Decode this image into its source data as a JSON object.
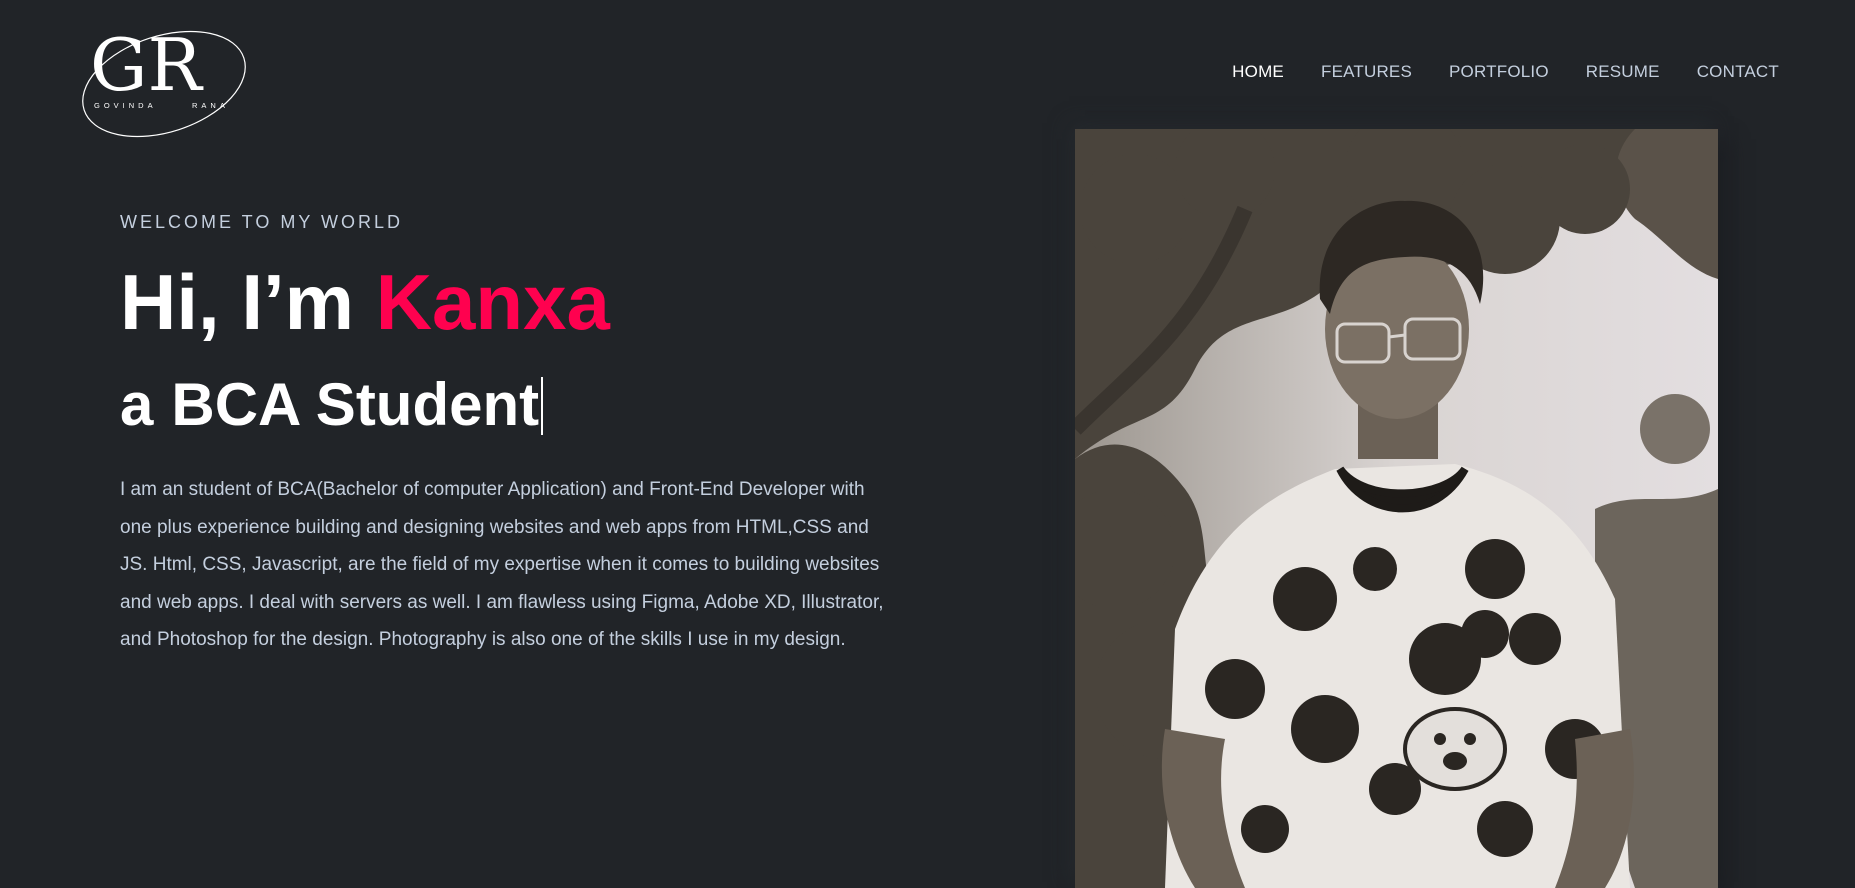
{
  "brand": {
    "monogram": "GR",
    "first_name": "GOVINDA",
    "last_name": "RANA"
  },
  "nav": {
    "items": [
      {
        "label": "HOME",
        "active": true
      },
      {
        "label": "FEATURES",
        "active": false
      },
      {
        "label": "PORTFOLIO",
        "active": false
      },
      {
        "label": "RESUME",
        "active": false
      },
      {
        "label": "CONTACT",
        "active": false
      }
    ]
  },
  "hero": {
    "welcome": "WELCOME TO MY WORLD",
    "greeting": "Hi, I’m ",
    "name": "Kanxa",
    "role_prefix": "a",
    "role": "BCA Student",
    "bio": "I am an student of BCA(Bachelor of computer Application) and Front-End Developer with one plus experience building and designing websites and web apps from HTML,CSS and JS. Html, CSS, Javascript, are the field of my expertise when it comes to building websites and web apps. I deal with servers as well. I am flawless using Figma, Adobe XD, Illustrator, and Photoshop for the design. Photography is also one of the skills I use in my design."
  },
  "colors": {
    "background": "#212428",
    "accent": "#ff014f",
    "text": "#c4cfde",
    "heading": "#ffffff"
  },
  "photo": {
    "subject": "portrait-photo"
  }
}
